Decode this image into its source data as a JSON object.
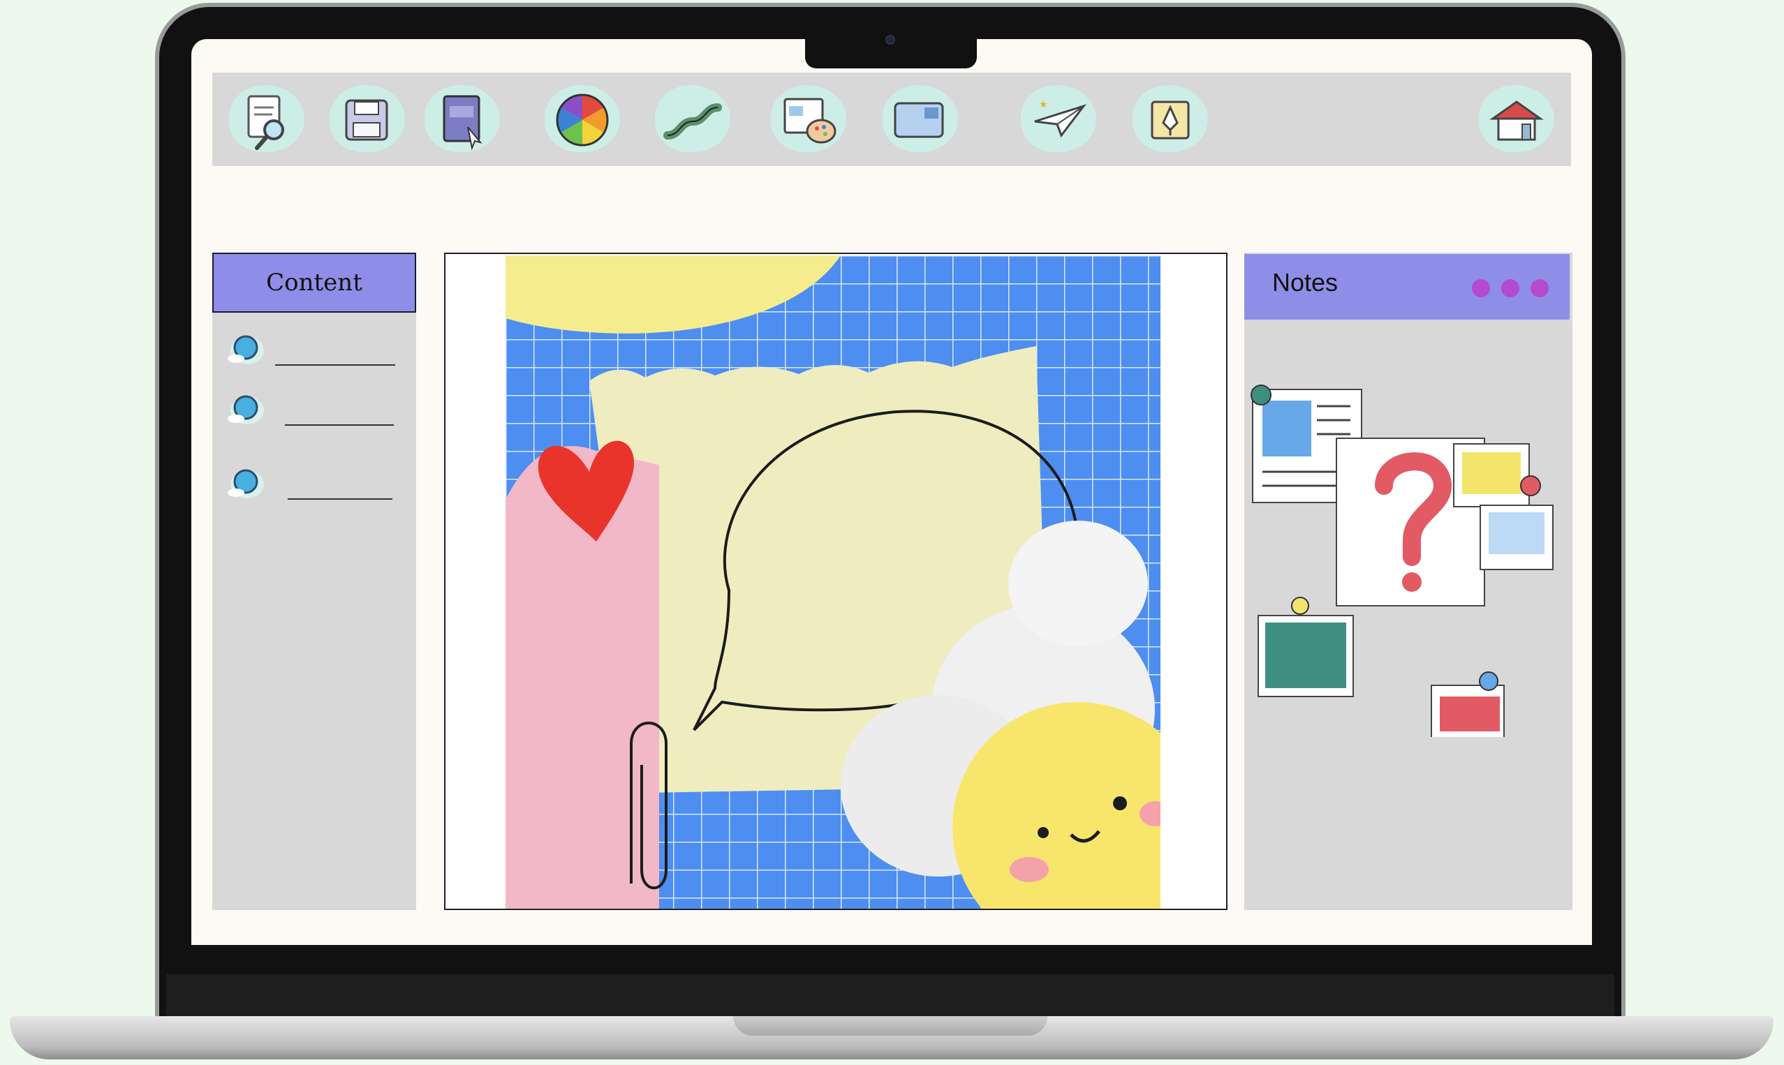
{
  "screen": {
    "toolbar": {
      "tools": [
        {
          "icon": "document-search-icon"
        },
        {
          "icon": "floppy-disk-icon"
        },
        {
          "icon": "book-cursor-icon"
        },
        {
          "icon": "color-wheel-icon"
        },
        {
          "icon": "squiggle-line-icon"
        },
        {
          "icon": "image-palette-icon"
        },
        {
          "icon": "image-frame-icon"
        },
        {
          "icon": "paper-plane-icon"
        },
        {
          "icon": "pen-tool-icon"
        },
        {
          "icon": "home-icon"
        }
      ]
    },
    "content_panel": {
      "title": "Content",
      "items": [
        {
          "icon": "globe-icon"
        },
        {
          "icon": "globe-icon"
        },
        {
          "icon": "globe-icon"
        }
      ]
    },
    "notes_panel": {
      "title": "Notes",
      "menu_icon": "more-dots-icon"
    },
    "colors": {
      "header_accent": "#8e8ee8",
      "panel_bg": "#d8d8d8",
      "dots": "#b44bcf"
    }
  }
}
